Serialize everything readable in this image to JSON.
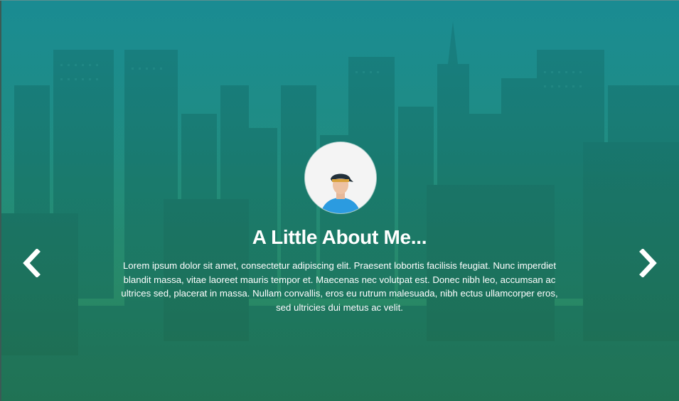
{
  "about": {
    "heading": "A Little About Me...",
    "bio": "Lorem ipsum dolor sit amet, consectetur adipiscing elit. Praesent lobortis facilisis feugiat. Nunc imperdiet blandit massa, vitae laoreet mauris tempor et. Maecenas nec volutpat est. Donec nibh leo, accumsan ac ultrices sed, placerat in massa. Nullam convallis, eros eu rutrum malesuada, nibh ectus ullamcorper eros, sed ultricies dui metus ac velit."
  },
  "carousel": {
    "prev_icon": "chevron-left-icon",
    "next_icon": "chevron-right-icon"
  },
  "colors": {
    "gradient_top": "#1d8a8e",
    "gradient_bottom": "#2d7f53",
    "text": "#ffffff"
  }
}
